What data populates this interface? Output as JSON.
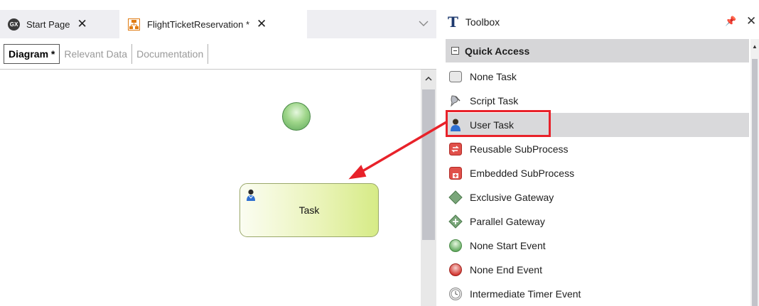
{
  "editor": {
    "tabs": [
      {
        "label": "Start Page",
        "icon": "gx-icon"
      },
      {
        "label": "FlightTicketReservation *",
        "icon": "process-diagram-icon"
      }
    ],
    "subtabs": [
      "Diagram *",
      "Relevant Data",
      "Documentation"
    ],
    "diagram": {
      "task_label": "Task"
    }
  },
  "toolbox": {
    "title": "Toolbox",
    "section": "Quick Access",
    "items": [
      {
        "label": "None Task",
        "icon": "none-task-icon"
      },
      {
        "label": "Script Task",
        "icon": "script-task-icon"
      },
      {
        "label": "User Task",
        "icon": "user-task-icon"
      },
      {
        "label": "Reusable SubProcess",
        "icon": "reusable-subprocess-icon"
      },
      {
        "label": "Embedded SubProcess",
        "icon": "embedded-subprocess-icon"
      },
      {
        "label": "Exclusive Gateway",
        "icon": "exclusive-gateway-icon"
      },
      {
        "label": "Parallel Gateway",
        "icon": "parallel-gateway-icon"
      },
      {
        "label": "None Start Event",
        "icon": "start-event-icon"
      },
      {
        "label": "None End Event",
        "icon": "end-event-icon"
      },
      {
        "label": "Intermediate Timer Event",
        "icon": "timer-event-icon"
      }
    ]
  },
  "colors": {
    "highlight_frame": "#e8222a",
    "arrow": "#e8222a"
  }
}
